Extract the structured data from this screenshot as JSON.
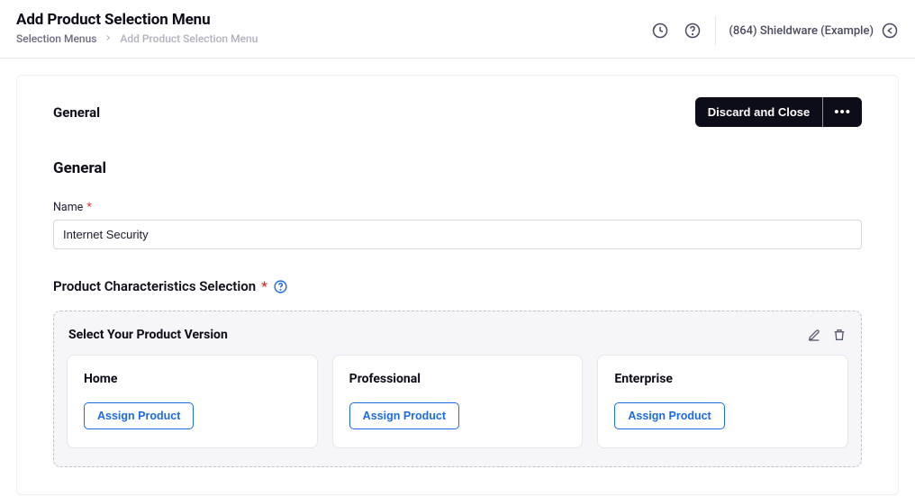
{
  "header": {
    "title": "Add Product Selection Menu",
    "breadcrumb": {
      "parent": "Selection Menus",
      "current": "Add Product Selection Menu"
    },
    "account": "(864) Shieldware (Example)"
  },
  "card": {
    "tab": "General",
    "actions": {
      "discard": "Discard and Close"
    }
  },
  "form": {
    "sectionHeading": "General",
    "nameLabel": "Name",
    "nameValue": "Internet Security",
    "characteristicsHeading": "Product Characteristics Selection"
  },
  "versionBlock": {
    "title": "Select Your Product Version",
    "assignLabel": "Assign Product",
    "cards": [
      {
        "title": "Home"
      },
      {
        "title": "Professional"
      },
      {
        "title": "Enterprise"
      }
    ]
  }
}
